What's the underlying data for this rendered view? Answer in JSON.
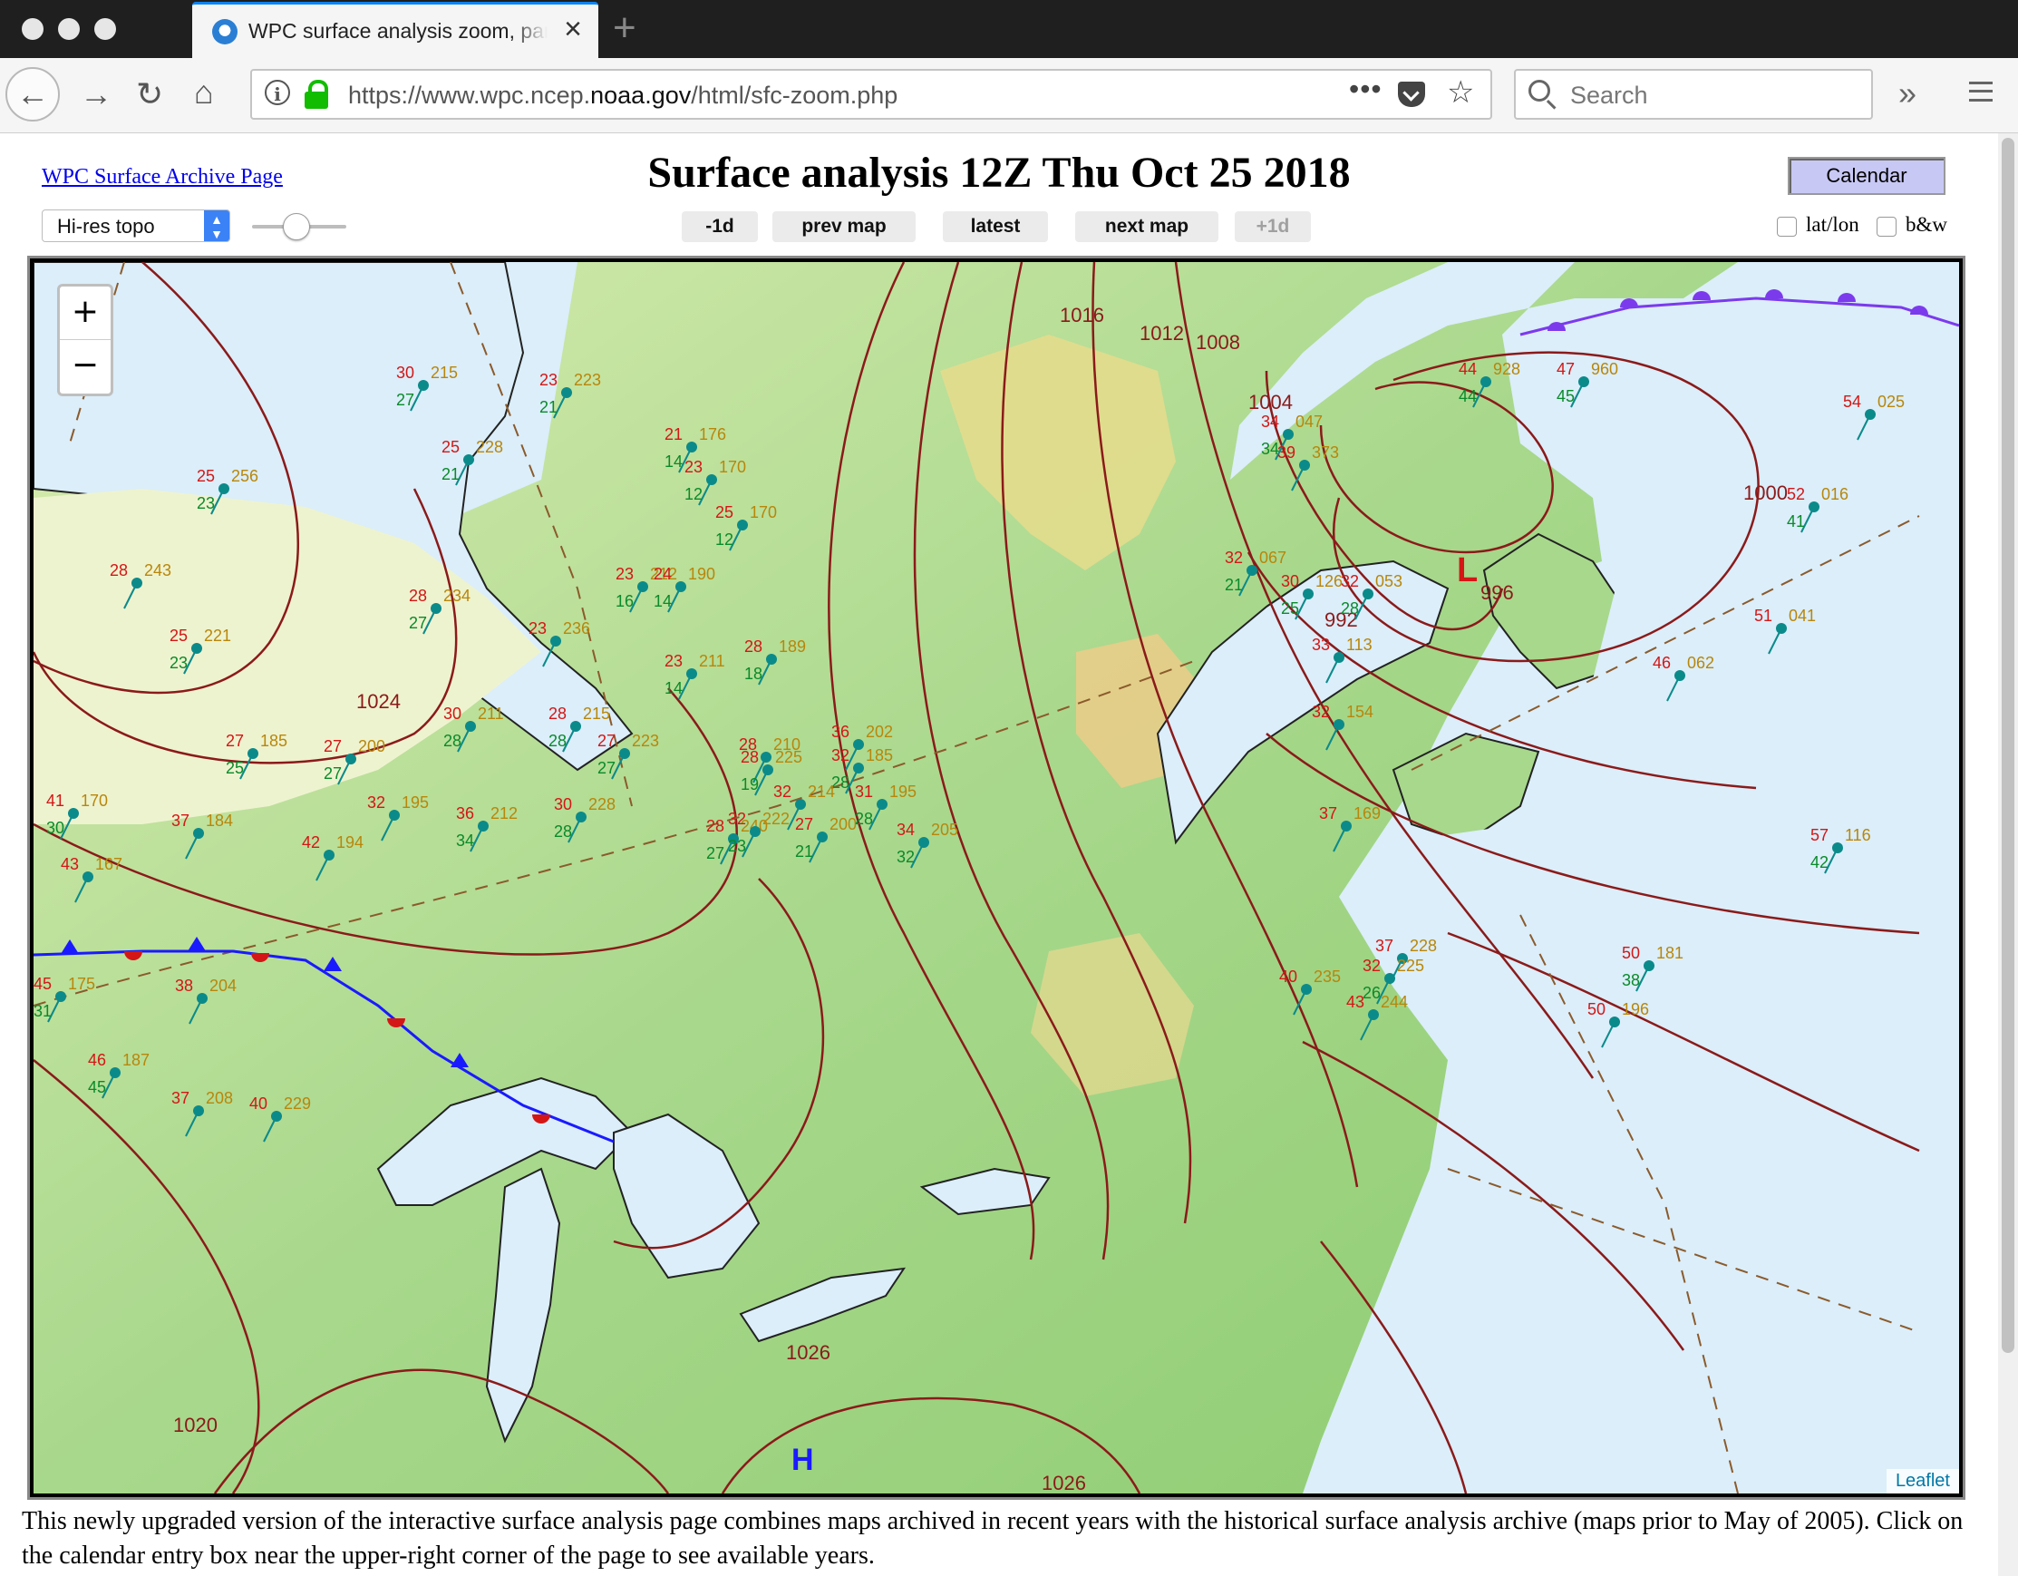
{
  "browser": {
    "tab_title": "WPC surface analysis zoom, pan",
    "url_prefix": "https://www.wpc.ncep.",
    "url_domain": "noaa.gov",
    "url_path": "/html/sfc-zoom.php",
    "search_placeholder": "Search"
  },
  "page": {
    "archive_link": "WPC Surface Archive Page",
    "title": "Surface analysis 12Z Thu Oct 25 2018",
    "calendar_label": "Calendar",
    "map_type_selected": "Hi-res topo",
    "nav_buttons": [
      "-1d",
      "prev map",
      "latest",
      "next map",
      "+1d"
    ],
    "checkbox_latlon": "lat/lon",
    "checkbox_bw": "b&w",
    "footer": "This newly upgraded version of the interactive surface analysis page combines maps archived in recent years with the historical surface analysis archive (maps prior to May of 2005). Click on the calendar entry box near the upper-right corner of the page to see available years."
  },
  "map": {
    "zoom_in": "+",
    "zoom_out": "−",
    "attribution": "Leaflet",
    "isobar_labels": [
      "1016",
      "1012",
      "1008",
      "1004",
      "1000",
      "992",
      "1024",
      "1020",
      "1026",
      "1026"
    ],
    "pressure_centers": [
      {
        "symbol": "L",
        "value": "996"
      },
      {
        "symbol": "H",
        "value": "1026"
      }
    ],
    "station_plots": [
      {
        "t": "30",
        "p": "215",
        "d": "27"
      },
      {
        "t": "23",
        "p": "223",
        "d": "21"
      },
      {
        "t": "25",
        "p": "228",
        "d": "21"
      },
      {
        "t": "25",
        "p": "256",
        "d": "23"
      },
      {
        "t": "28",
        "p": "243",
        "d": ""
      },
      {
        "t": "28",
        "p": "234",
        "d": "27"
      },
      {
        "t": "25",
        "p": "221",
        "d": "23"
      },
      {
        "t": "23",
        "p": "236",
        "d": ""
      },
      {
        "t": "21",
        "p": "176",
        "d": "14"
      },
      {
        "t": "23",
        "p": "170",
        "d": "12"
      },
      {
        "t": "25",
        "p": "170",
        "d": "12"
      },
      {
        "t": "23",
        "p": "212",
        "d": "16"
      },
      {
        "t": "24",
        "p": "190",
        "d": "14"
      },
      {
        "t": "23",
        "p": "211",
        "d": "14"
      },
      {
        "t": "28",
        "p": "189",
        "d": "18"
      },
      {
        "t": "30",
        "p": "211",
        "d": "28"
      },
      {
        "t": "28",
        "p": "215",
        "d": "28"
      },
      {
        "t": "27",
        "p": "223",
        "d": "27"
      },
      {
        "t": "27",
        "p": "185",
        "d": "25"
      },
      {
        "t": "27",
        "p": "200",
        "d": "27"
      },
      {
        "t": "30",
        "p": "228",
        "d": "28"
      },
      {
        "t": "28",
        "p": "240",
        "d": "27"
      },
      {
        "t": "36",
        "p": "212",
        "d": "34"
      },
      {
        "t": "32",
        "p": "195",
        "d": ""
      },
      {
        "t": "41",
        "p": "170",
        "d": "30"
      },
      {
        "t": "37",
        "p": "184",
        "d": ""
      },
      {
        "t": "42",
        "p": "194",
        "d": ""
      },
      {
        "t": "28",
        "p": "210",
        "d": ""
      },
      {
        "t": "32",
        "p": "222",
        "d": "23"
      },
      {
        "t": "27",
        "p": "200",
        "d": "21"
      },
      {
        "t": "28",
        "p": "225",
        "d": "19"
      },
      {
        "t": "32",
        "p": "185",
        "d": "28"
      },
      {
        "t": "31",
        "p": "195",
        "d": "28"
      },
      {
        "t": "36",
        "p": "202",
        "d": ""
      },
      {
        "t": "32",
        "p": "214",
        "d": ""
      },
      {
        "t": "34",
        "p": "205",
        "d": "32"
      },
      {
        "t": "44",
        "p": "928",
        "d": "44"
      },
      {
        "t": "47",
        "p": "960",
        "d": "45"
      },
      {
        "t": "54",
        "p": "025",
        "d": ""
      },
      {
        "t": "52",
        "p": "016",
        "d": "41"
      },
      {
        "t": "51",
        "p": "041",
        "d": ""
      },
      {
        "t": "46",
        "p": "062",
        "d": ""
      },
      {
        "t": "57",
        "p": "116",
        "d": "42"
      },
      {
        "t": "50",
        "p": "181",
        "d": "38"
      },
      {
        "t": "50",
        "p": "196",
        "d": ""
      },
      {
        "t": "34",
        "p": "047",
        "d": "34"
      },
      {
        "t": "39",
        "p": "373",
        "d": ""
      },
      {
        "t": "32",
        "p": "067",
        "d": "21"
      },
      {
        "t": "30",
        "p": "126",
        "d": "25"
      },
      {
        "t": "32",
        "p": "053",
        "d": "28"
      },
      {
        "t": "33",
        "p": "113",
        "d": ""
      },
      {
        "t": "32",
        "p": "154",
        "d": ""
      },
      {
        "t": "37",
        "p": "169",
        "d": ""
      },
      {
        "t": "43",
        "p": "244",
        "d": ""
      },
      {
        "t": "37",
        "p": "228",
        "d": ""
      },
      {
        "t": "32",
        "p": "225",
        "d": "26"
      },
      {
        "t": "40",
        "p": "235",
        "d": ""
      },
      {
        "t": "45",
        "p": "175",
        "d": "31"
      },
      {
        "t": "38",
        "p": "204",
        "d": ""
      },
      {
        "t": "43",
        "p": "167",
        "d": ""
      },
      {
        "t": "46",
        "p": "187",
        "d": "45"
      },
      {
        "t": "37",
        "p": "208",
        "d": ""
      },
      {
        "t": "40",
        "p": "229",
        "d": ""
      }
    ]
  }
}
